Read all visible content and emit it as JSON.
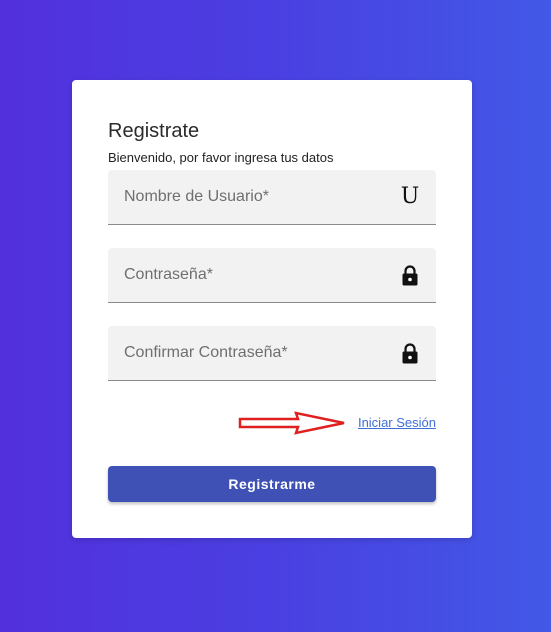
{
  "form": {
    "title": "Registrate",
    "subtitle": "Bienvenido, por favor ingresa tus datos",
    "fields": [
      {
        "placeholder": "Nombre de Usuario*",
        "value": "",
        "icon": "user-icon"
      },
      {
        "placeholder": "Contraseña*",
        "value": "",
        "icon": "lock-icon"
      },
      {
        "placeholder": "Confirmar Contraseña*",
        "value": "",
        "icon": "lock-icon"
      }
    ],
    "user_icon_glyph": "U",
    "login_link": "Iniciar Sesión",
    "submit_label": "Registrarme"
  },
  "colors": {
    "background_start": "#5230dc",
    "background_end": "#4258e6",
    "button": "#3f51b5",
    "link": "#3f6fd8",
    "arrow": "#e02020"
  }
}
